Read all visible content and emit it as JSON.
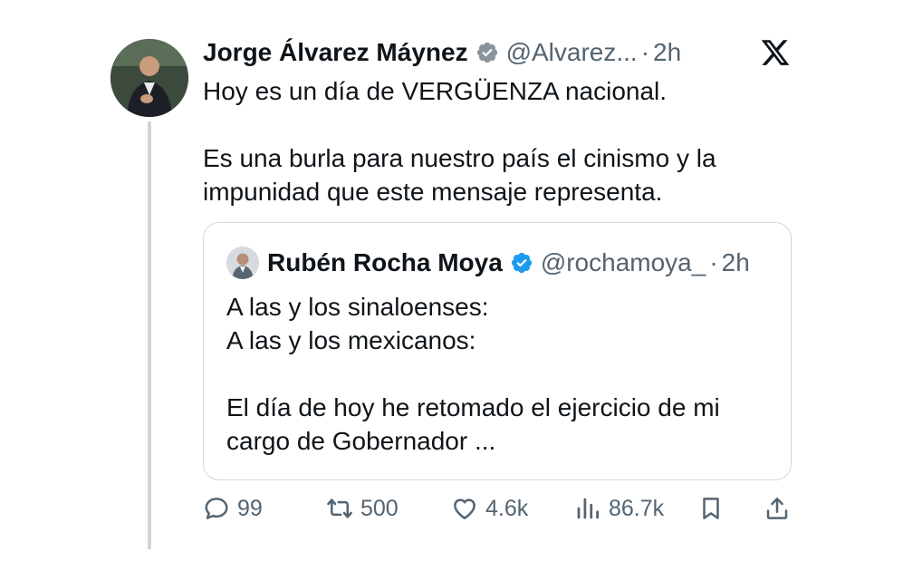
{
  "tweet": {
    "author_name": "Jorge Álvarez Máynez",
    "author_handle": "@Alvarez...",
    "dot": "·",
    "time": "2h",
    "paragraphs": [
      "Hoy es un día de VERGÜENZA nacional.",
      "Es una burla para nuestro país el cinismo y la impunidad que este mensaje representa."
    ]
  },
  "quoted": {
    "author_name": "Rubén Rocha Moya",
    "author_handle": "@rochamoya_",
    "dot": "·",
    "time": "2h",
    "paragraphs": [
      "A las y los sinaloenses:\nA las y los mexicanos:",
      "El día de hoy he retomado el ejercicio de mi cargo de Gobernador ..."
    ]
  },
  "actions": {
    "replies": "99",
    "reposts": "500",
    "likes": "4.6k",
    "views": "86.7k"
  },
  "colors": {
    "verified": "#1d9bf0",
    "muted": "#536471",
    "text": "#0f1419",
    "border": "#cfd9de",
    "thread_line": "#d0d5da"
  },
  "icons": [
    "verified-badge-icon",
    "x-logo-icon",
    "reply-icon",
    "repost-icon",
    "like-icon",
    "views-icon",
    "bookmark-icon",
    "share-icon"
  ]
}
